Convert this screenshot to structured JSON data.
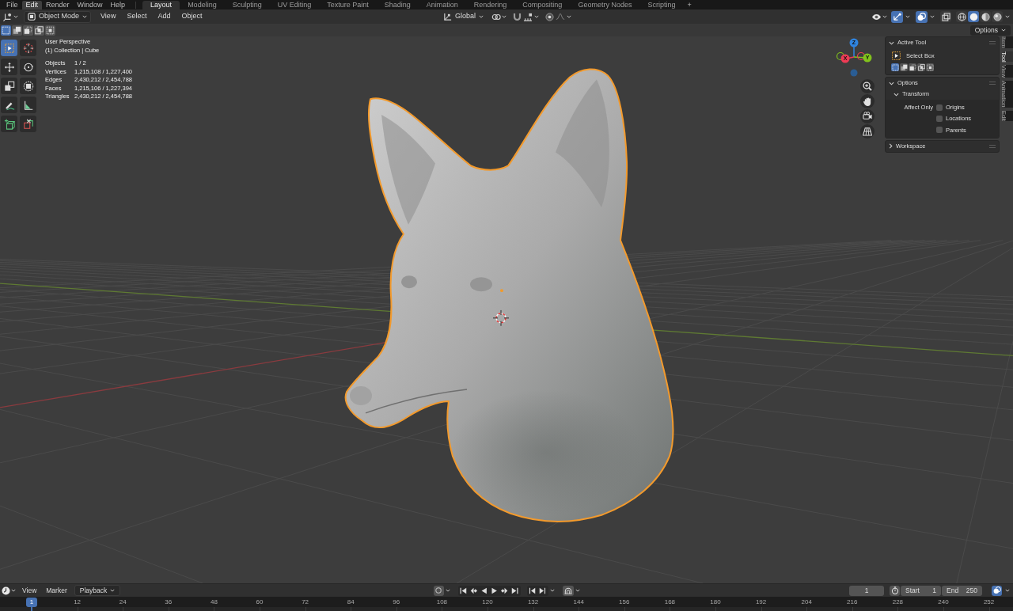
{
  "menu_bar": {
    "menus": [
      {
        "label": "File",
        "highlighted": false
      },
      {
        "label": "Edit",
        "highlighted": true
      },
      {
        "label": "Render",
        "highlighted": false
      },
      {
        "label": "Window",
        "highlighted": false
      },
      {
        "label": "Help",
        "highlighted": false
      }
    ],
    "workspaces": [
      {
        "label": "Layout",
        "selected": true
      },
      {
        "label": "Modeling",
        "selected": false
      },
      {
        "label": "Sculpting",
        "selected": false
      },
      {
        "label": "UV Editing",
        "selected": false
      },
      {
        "label": "Texture Paint",
        "selected": false
      },
      {
        "label": "Shading",
        "selected": false
      },
      {
        "label": "Animation",
        "selected": false
      },
      {
        "label": "Rendering",
        "selected": false
      },
      {
        "label": "Compositing",
        "selected": false
      },
      {
        "label": "Geometry Nodes",
        "selected": false
      },
      {
        "label": "Scripting",
        "selected": false
      }
    ],
    "add_workspace": "+"
  },
  "viewport_header": {
    "mode": "Object Mode",
    "menus": [
      "View",
      "Select",
      "Add",
      "Object"
    ],
    "orientation": "Global",
    "gizmos_on": true,
    "overlays_on": true,
    "xray_on": false,
    "shading_modes": [
      {
        "kind": "wireframe",
        "selected": false
      },
      {
        "kind": "solid",
        "selected": true
      },
      {
        "kind": "material",
        "selected": false
      },
      {
        "kind": "rendered",
        "selected": false
      }
    ]
  },
  "tool_settings": {
    "select_modes": [
      {
        "kind": "set",
        "selected": true
      },
      {
        "kind": "extend",
        "selected": false
      },
      {
        "kind": "subtract",
        "selected": false
      },
      {
        "kind": "invert",
        "selected": false
      },
      {
        "kind": "intersect",
        "selected": false
      }
    ],
    "options": "Options"
  },
  "toolbar": {
    "tools": [
      {
        "kind": "select_box",
        "selected": true
      },
      {
        "kind": "cursor",
        "selected": false
      },
      {
        "kind": "move",
        "selected": false
      },
      {
        "kind": "rotate",
        "selected": false
      },
      {
        "kind": "scale",
        "selected": false
      },
      {
        "kind": "transform",
        "selected": false
      },
      {
        "kind": "annotate",
        "selected": false
      },
      {
        "kind": "measure",
        "selected": false
      },
      {
        "kind": "add_cube",
        "selected": false
      },
      {
        "kind": "cut_cube",
        "selected": false
      }
    ]
  },
  "viewport": {
    "view_name": "User Perspective",
    "collection": "(1) Collection | Cube",
    "stats": [
      {
        "label": "Objects",
        "value": "1 / 2"
      },
      {
        "label": "Vertices",
        "value": "1,215,108 / 1,227,400"
      },
      {
        "label": "Edges",
        "value": "2,430,212 / 2,454,788"
      },
      {
        "label": "Faces",
        "value": "1,215,106 / 1,227,394"
      },
      {
        "label": "Triangles",
        "value": "2,430,212 / 2,454,788"
      }
    ]
  },
  "navigation_gizmo": {
    "axes": [
      {
        "label": "Z",
        "color": "#2f84e0"
      },
      {
        "label": "X",
        "color": "#ee3b55"
      },
      {
        "label": "Y",
        "color": "#82c21d"
      }
    ]
  },
  "sidebar": {
    "active_tool": {
      "title": "Active Tool",
      "expanded": true,
      "tool": "Select Box",
      "select_modes": [
        {
          "kind": "set",
          "selected": true
        },
        {
          "kind": "extend",
          "selected": false
        },
        {
          "kind": "subtract",
          "selected": false
        },
        {
          "kind": "invert",
          "selected": false
        },
        {
          "kind": "intersect",
          "selected": false
        }
      ]
    },
    "options": {
      "title": "Options",
      "expanded": true,
      "transform": {
        "title": "Transform",
        "expanded": true,
        "affect_only": "Affect Only",
        "checkboxes": [
          {
            "label": "Origins",
            "checked": false
          },
          {
            "label": "Locations",
            "checked": false
          },
          {
            "label": "Parents",
            "checked": false
          }
        ]
      }
    },
    "workspace": {
      "title": "Workspace",
      "expanded": false
    },
    "tabs": [
      {
        "label": "Item",
        "selected": false
      },
      {
        "label": "Tool",
        "selected": true
      },
      {
        "label": "View",
        "selected": false
      },
      {
        "label": "Animation",
        "selected": false
      },
      {
        "label": "Edit",
        "selected": false
      }
    ]
  },
  "timeline": {
    "menus": [
      "View",
      "Marker"
    ],
    "playback": "Playback",
    "auto_keying_on": false,
    "current_frame": "1",
    "start_label": "Start",
    "start": "1",
    "end_label": "End",
    "end": "250",
    "playhead": "1",
    "ruler": [
      "12",
      "24",
      "36",
      "48",
      "60",
      "72",
      "84",
      "96",
      "108",
      "120",
      "132",
      "144",
      "156",
      "168",
      "180",
      "192",
      "204",
      "216",
      "228",
      "240",
      "252"
    ]
  }
}
